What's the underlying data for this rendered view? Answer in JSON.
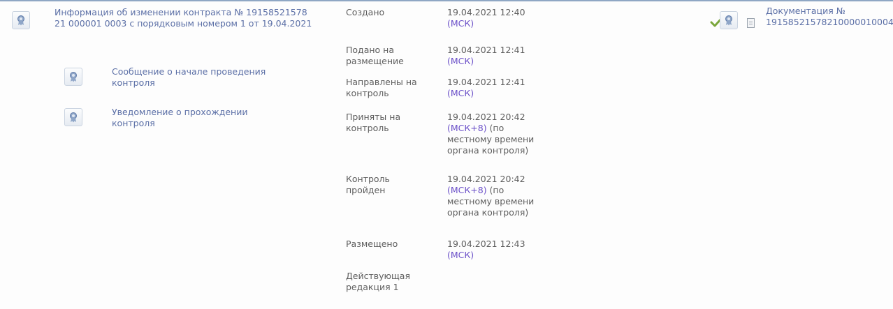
{
  "contract": {
    "title": "Информация об изменении контракта № 19158521578 21 000001 0003 с порядковым номером 1 от 19.04.2021",
    "sub_items": [
      {
        "label": "Сообщение о начале проведения контроля"
      },
      {
        "label": "Уведомление о прохождении контроля"
      }
    ]
  },
  "events": [
    {
      "label": "Создано",
      "datetime": "19.04.2021 12:40",
      "tz": "(МСК)",
      "note": ""
    },
    {
      "label": "Подано на размещение",
      "datetime": "19.04.2021 12:41",
      "tz": "(МСК)",
      "note": ""
    },
    {
      "label": "Направлены на контроль",
      "datetime": "19.04.2021 12:41",
      "tz": "(МСК)",
      "note": ""
    },
    {
      "label": "Приняты на контроль",
      "datetime": "19.04.2021 20:42",
      "tz": "(МСК+8)",
      "note": " (по местному времени органа контроля)"
    },
    {
      "label": "Контроль пройден",
      "datetime": "19.04.2021 20:42",
      "tz": "(МСК+8)",
      "note": " (по местному времени органа контроля)"
    },
    {
      "label": "Размещено",
      "datetime": "19.04.2021 12:43",
      "tz": "(МСК)",
      "note": ""
    },
    {
      "label": "Действующая редакция 1",
      "datetime": "",
      "tz": "",
      "note": ""
    }
  ],
  "documentation": {
    "label": "Документация № 19158521578210000010004"
  },
  "icons": {
    "signature": "certificate-seal-icon",
    "check": "checkmark-icon",
    "document": "document-icon"
  },
  "colors": {
    "link": "#5b6fa6",
    "timezone": "#6a4fc8",
    "check": "#7aa63a"
  }
}
